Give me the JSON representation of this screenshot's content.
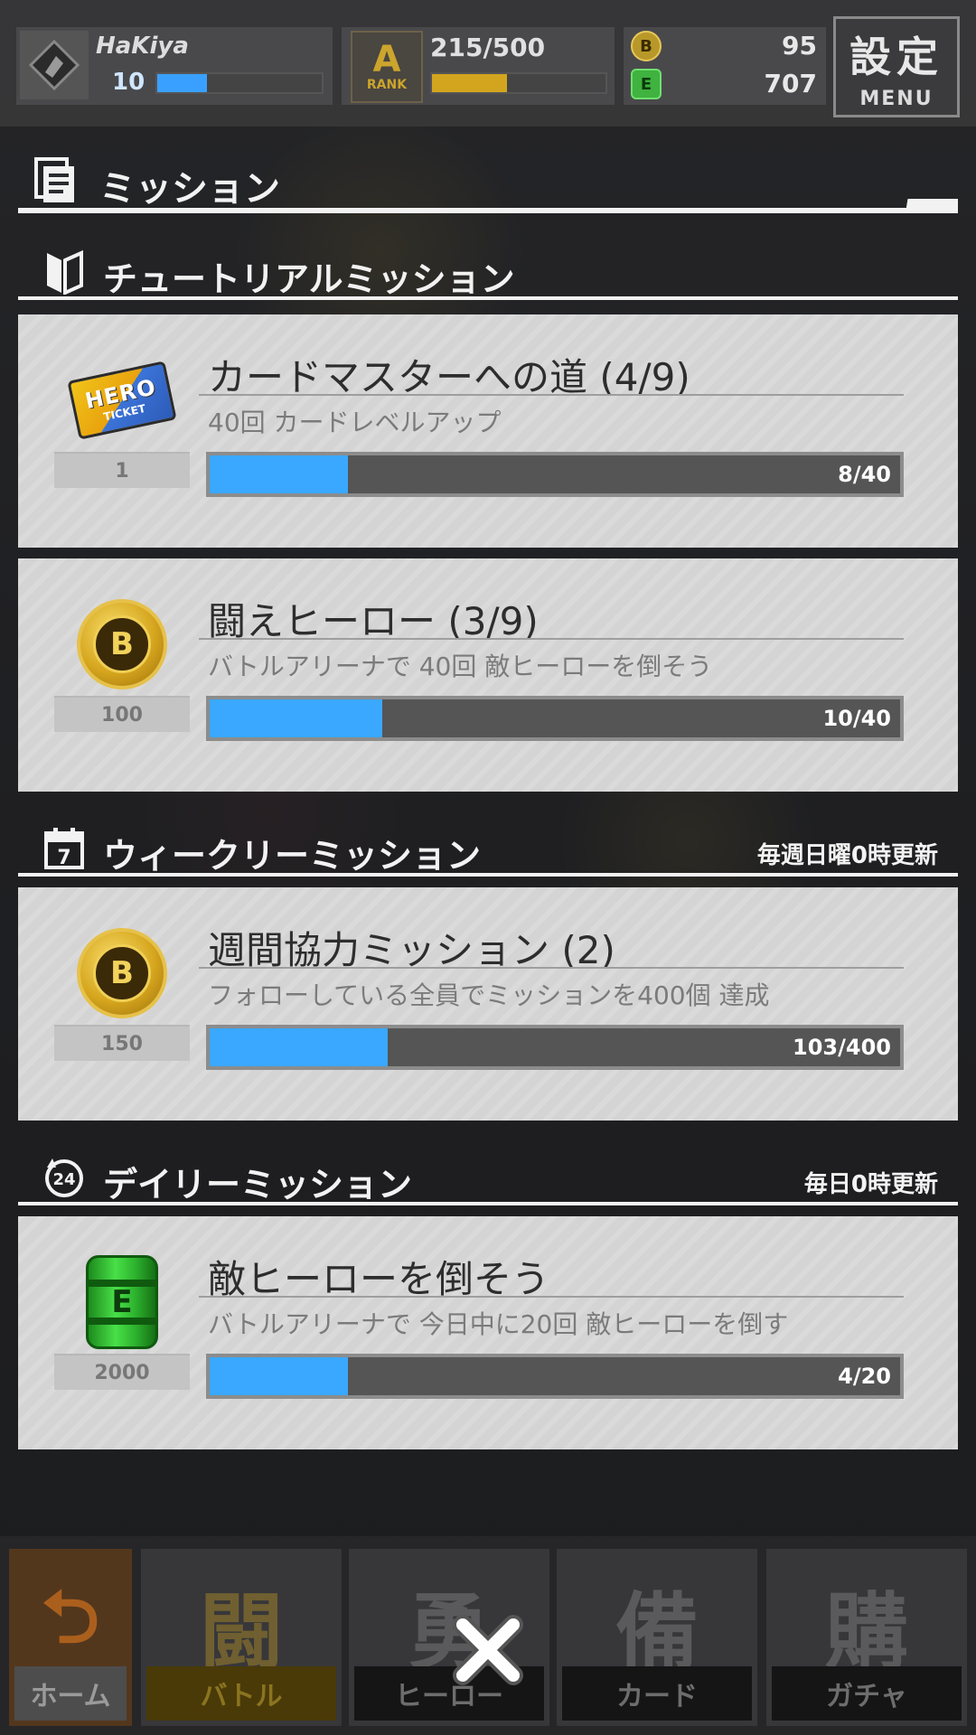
{
  "player": {
    "name": "HaKiya",
    "level": "10",
    "xp_progress": 0.3
  },
  "rank": {
    "emblem_letter": "A",
    "label": "RANK",
    "value": "215/500",
    "progress": 0.43
  },
  "currency": {
    "coin_icon": "coin-icon",
    "coin_value": "95",
    "energy_icon": "energy-can-icon",
    "energy_value": "707"
  },
  "menu": {
    "kanji": "設定",
    "label": "MENU"
  },
  "page": {
    "title": "ミッション"
  },
  "sections": {
    "tutorial": {
      "title": "チュートリアルミッション",
      "note": ""
    },
    "weekly": {
      "title": "ウィークリーミッション",
      "note": "毎週日曜0時更新"
    },
    "daily": {
      "title": "デイリーミッション",
      "note": "毎日0時更新"
    }
  },
  "missions": [
    {
      "reward_icon": "hero-ticket-icon",
      "reward_qty": "1",
      "title": "カードマスターへの道 (4/9)",
      "description": "40回 カードレベルアップ",
      "progress_text": "8/40",
      "progress": 0.2
    },
    {
      "reward_icon": "coin-icon",
      "reward_qty": "100",
      "title": "闘えヒーロー (3/9)",
      "description": "バトルアリーナで 40回 敵ヒーローを倒そう",
      "progress_text": "10/40",
      "progress": 0.25
    },
    {
      "reward_icon": "coin-icon",
      "reward_qty": "150",
      "title": "週間協力ミッション (2)",
      "description": "フォローしている全員でミッションを400個 達成",
      "progress_text": "103/400",
      "progress": 0.2575
    },
    {
      "reward_icon": "energy-can-icon",
      "reward_qty": "2000",
      "title": "敵ヒーローを倒そう",
      "description": "バトルアリーナで 今日中に20回 敵ヒーローを倒す",
      "progress_text": "4/20",
      "progress": 0.2
    }
  ],
  "icons": {
    "ticket_text": "HERO",
    "ticket_sub": "TICKET",
    "coin_mark": "B",
    "can_mark": "E"
  },
  "nav": {
    "home": {
      "label": "ホーム",
      "glyph": "⮌"
    },
    "battle": {
      "label": "バトル",
      "glyph": "闘"
    },
    "hero": {
      "label": "ヒーロー",
      "glyph": "勇"
    },
    "card": {
      "label": "カード",
      "glyph": "備"
    },
    "gacha": {
      "label": "ガチャ",
      "glyph": "購"
    }
  },
  "colors": {
    "progress_fill": "#3aa8ff",
    "rank_fill": "#d3a51f",
    "card_bg": "#d4d4d4"
  }
}
